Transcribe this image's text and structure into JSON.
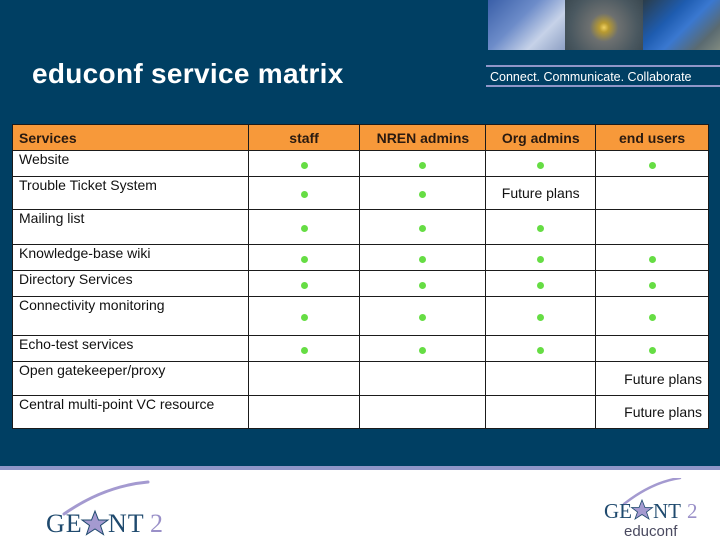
{
  "slide": {
    "title": "educonf service matrix",
    "tagline": "Connect. Communicate. Collaborate",
    "colors": {
      "background": "#003f63",
      "header_row": "#f7993a",
      "available_dot": "#66dd44",
      "accent_band": "#8f96c8"
    }
  },
  "table": {
    "headers": [
      "Services",
      "staff",
      "NREN admins",
      "Org admins",
      "end users"
    ],
    "rows": [
      {
        "service": "Website",
        "cells": [
          "available",
          "available",
          "available",
          "available"
        ]
      },
      {
        "service": "Trouble Ticket System",
        "cells": [
          "available",
          "available",
          "Future plans",
          ""
        ]
      },
      {
        "service": "Mailing list",
        "cells": [
          "available",
          "available",
          "available",
          ""
        ]
      },
      {
        "service": "Knowledge-base wiki",
        "cells": [
          "available",
          "available",
          "available",
          "available"
        ]
      },
      {
        "service": "Directory Services",
        "cells": [
          "available",
          "available",
          "available",
          "available"
        ]
      },
      {
        "service": "Connectivity monitoring",
        "cells": [
          "available",
          "available",
          "available",
          "available"
        ]
      },
      {
        "service": "Echo-test services",
        "cells": [
          "available",
          "available",
          "available",
          "available"
        ]
      },
      {
        "service": "Open gatekeeper/proxy",
        "cells": [
          "",
          "",
          "",
          "Future plans"
        ]
      },
      {
        "service": "Central multi-point VC resource",
        "cells": [
          "",
          "",
          "",
          "Future plans"
        ]
      }
    ]
  },
  "footer": {
    "logo_left": {
      "text": "GEANT2",
      "icon": "star-icon"
    },
    "logo_right": {
      "text": "GEANT2",
      "subtext": "educonf",
      "icon": "star-icon"
    }
  }
}
